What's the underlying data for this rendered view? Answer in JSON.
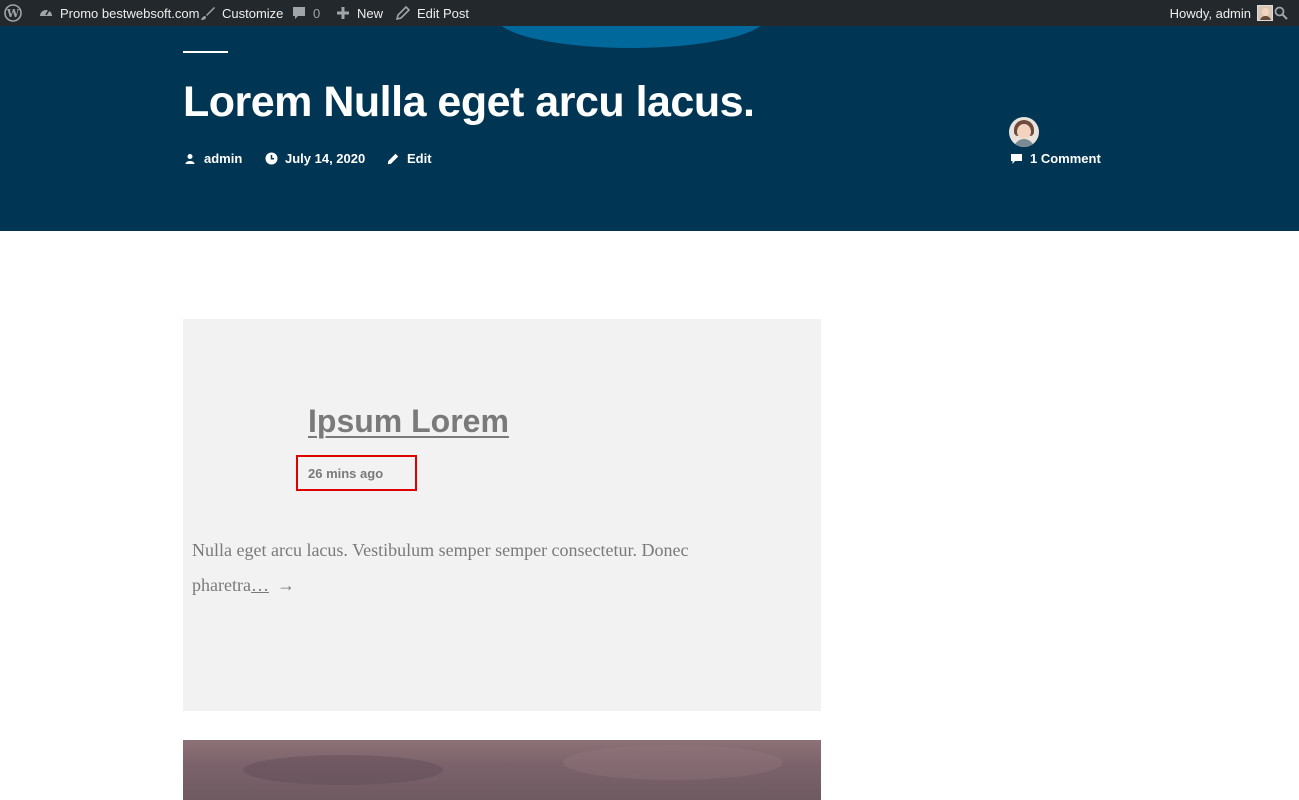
{
  "admin_bar": {
    "site_name": "Promo bestwebsoft.com",
    "customize_label": "Customize",
    "comments_count": "0",
    "new_label": "New",
    "edit_post_label": "Edit Post",
    "howdy_label": "Howdy, admin"
  },
  "header": {
    "post_title": "Lorem Nulla eget arcu lacus.",
    "author": "admin",
    "date": "July 14, 2020",
    "edit_label": "Edit",
    "comments_label": "1 Comment"
  },
  "post_card": {
    "title": "Ipsum Lorem",
    "time_ago": "26 mins ago",
    "excerpt_line1": "Nulla eget arcu lacus. Vestibulum semper semper consectetur. Donec",
    "excerpt_line2_text": "pharetra",
    "excerpt_more": "…",
    "excerpt_arrow": "→"
  },
  "colors": {
    "admin_bar_bg": "#23282d",
    "header_bg": "#003553",
    "card_bg": "#f2f2f2",
    "highlight_border": "#e00000"
  },
  "icons": [
    "wordpress-icon",
    "dashboard-icon",
    "brush-icon",
    "comment-bubble-icon",
    "plus-icon",
    "pencil-icon",
    "search-icon",
    "person-icon",
    "clock-icon",
    "comment-icon"
  ]
}
